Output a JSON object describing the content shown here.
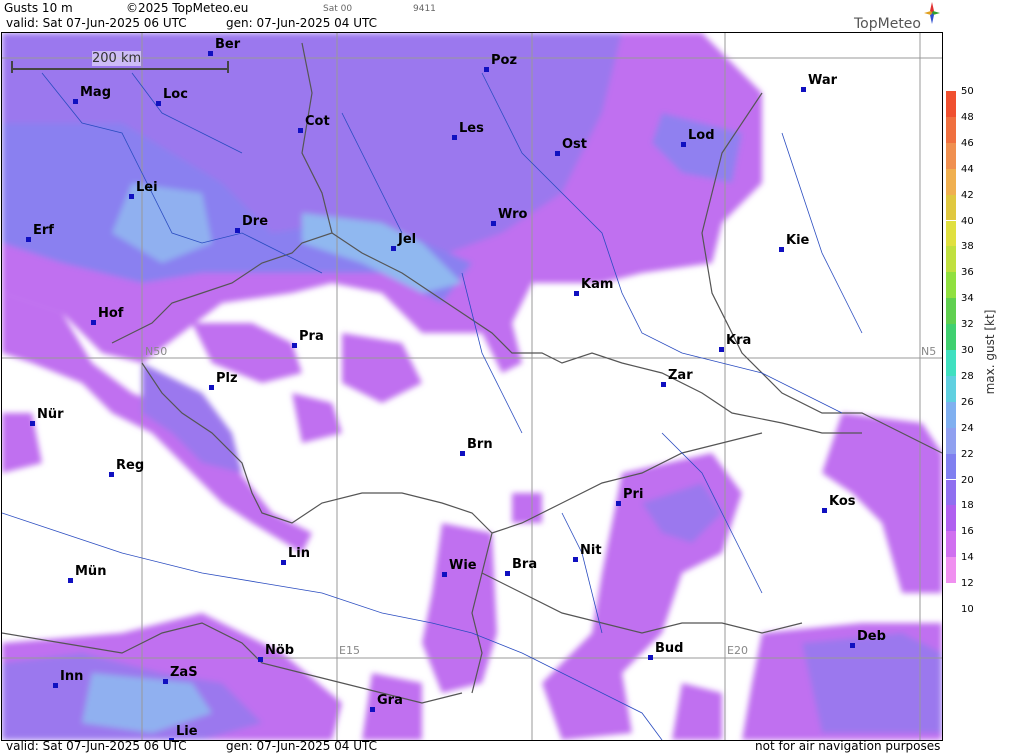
{
  "header": {
    "title": "Gusts 10 m",
    "copyright": "©2025 TopMeteo.eu",
    "valid": "valid:  Sat  07-Jun-2025  06 UTC",
    "gen": "gen: 07-Jun-2025 04 UTC",
    "sat": "Sat 00",
    "code": "9411",
    "logo": "TopMeteo"
  },
  "footer": {
    "valid": "valid:  Sat  07-Jun-2025  06 UTC",
    "gen": "gen: 07-Jun-2025 04 UTC",
    "notice": "not for air navigation purposes"
  },
  "scale_bar": "200 km",
  "grid_labels": {
    "n50": "N50",
    "n5": "N5",
    "e15": "E15",
    "e20": "E20"
  },
  "legend": {
    "title": "max. gust [kt]",
    "ticks": [
      "50",
      "48",
      "46",
      "44",
      "42",
      "40",
      "38",
      "36",
      "34",
      "32",
      "30",
      "28",
      "26",
      "24",
      "22",
      "20",
      "18",
      "16",
      "14",
      "12",
      "10"
    ],
    "colors": [
      "#f05030",
      "#f07040",
      "#f09050",
      "#f0b050",
      "#e0c840",
      "#e0e040",
      "#c0e040",
      "#90e040",
      "#60d050",
      "#40d070",
      "#40e0c0",
      "#60d0e0",
      "#80b0f0",
      "#90a0f0",
      "#8080f0",
      "#9070f0",
      "#b060f0",
      "#d070f0",
      "#f090f0",
      "#ffffff"
    ]
  },
  "cities": [
    {
      "name": "Ber"
    },
    {
      "name": "Poz"
    },
    {
      "name": "War"
    },
    {
      "name": "Mag"
    },
    {
      "name": "Loc"
    },
    {
      "name": "Cot"
    },
    {
      "name": "Les"
    },
    {
      "name": "Ost"
    },
    {
      "name": "Lod"
    },
    {
      "name": "Lei"
    },
    {
      "name": "Erf"
    },
    {
      "name": "Dre"
    },
    {
      "name": "Wro"
    },
    {
      "name": "Jel"
    },
    {
      "name": "Kie"
    },
    {
      "name": "Kam"
    },
    {
      "name": "Hof"
    },
    {
      "name": "Pra"
    },
    {
      "name": "Kra"
    },
    {
      "name": "Plz"
    },
    {
      "name": "Zar"
    },
    {
      "name": "Nür"
    },
    {
      "name": "Brn"
    },
    {
      "name": "Reg"
    },
    {
      "name": "Pri"
    },
    {
      "name": "Kos"
    },
    {
      "name": "Lin"
    },
    {
      "name": "Nit"
    },
    {
      "name": "Wie"
    },
    {
      "name": "Bra"
    },
    {
      "name": "Mün"
    },
    {
      "name": "Deb"
    },
    {
      "name": "Bud"
    },
    {
      "name": "Nöb"
    },
    {
      "name": "Inn"
    },
    {
      "name": "ZaS"
    },
    {
      "name": "Gra"
    },
    {
      "name": "Lie"
    }
  ]
}
